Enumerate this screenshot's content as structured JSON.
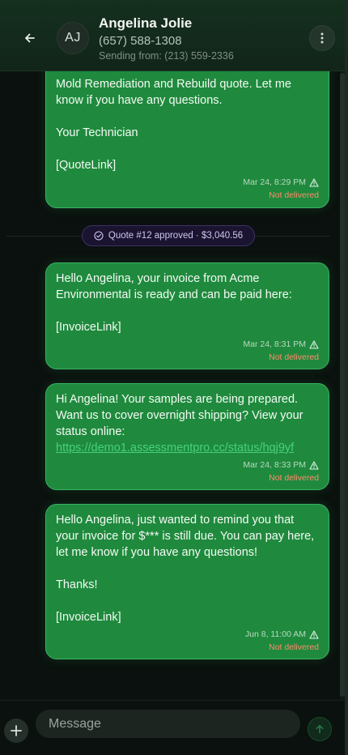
{
  "header": {
    "back_icon": "arrow-left-icon",
    "avatar_initials": "AJ",
    "contact_name": "Angelina Jolie",
    "contact_phone": "(657) 588-1308",
    "sending_from": "Sending from: (213) 559-2336",
    "menu_icon": "kebab-menu-icon"
  },
  "messages": [
    {
      "text": "Mold Remediation and Rebuild quote. Let me\nknow if you have any questions.\n\nYour Technician\n\n[QuoteLink]",
      "time": "Mar 24, 8:29 PM",
      "status": "Not delivered"
    },
    {
      "text": "Hello Angelina, your invoice from Acme\nEnvironmental is ready and can be paid here:\n\n[InvoiceLink]",
      "time": "Mar 24, 8:31 PM",
      "status": "Not delivered"
    },
    {
      "text_before_link": "Hi Angelina! Your samples are being prepared.\nWant us to cover overnight shipping? View your\nstatus online: ",
      "link": "https://demo1.assessmentpro.cc/status/hqj9yf",
      "time": "Mar 24, 8:33 PM",
      "status": "Not delivered"
    },
    {
      "text": "Hello Angelina, just wanted to remind you that\nyour invoice for $*** is still due. You can pay here,\nlet me know if you have any questions!\n\nThanks!\n\n[InvoiceLink]",
      "time": "Jun 8, 11:00 AM",
      "status": "Not delivered"
    }
  ],
  "quote_event": {
    "label": "Quote #12 approved · $3,040.56"
  },
  "composer": {
    "placeholder": "Message"
  },
  "colors": {
    "bubble": "#1f8a3d",
    "bubble_border": "#3ab365",
    "not_delivered": "#ff8a6b",
    "link": "#47d17c",
    "pill_bg": "#1b1430"
  }
}
